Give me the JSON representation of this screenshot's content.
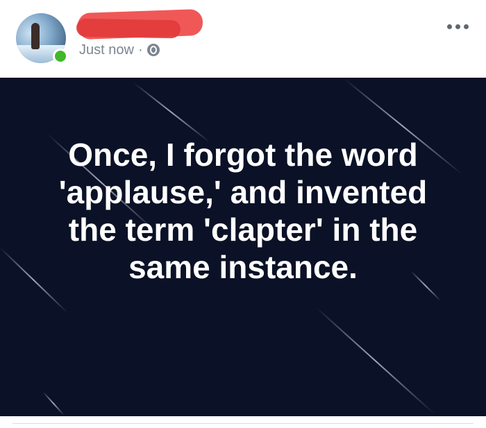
{
  "post": {
    "timestamp": "Just now",
    "separator": "·",
    "privacy_icon": "globe-icon",
    "more_icon": "more-options-icon",
    "online_status_color": "#42b72a",
    "image_text": "Once, I forgot the word 'applause,' and invented the term 'clapter' in the same instance."
  },
  "colors": {
    "image_background": "#0b1126",
    "redaction": "#ef4a4a",
    "meta_text": "#7c8591"
  }
}
